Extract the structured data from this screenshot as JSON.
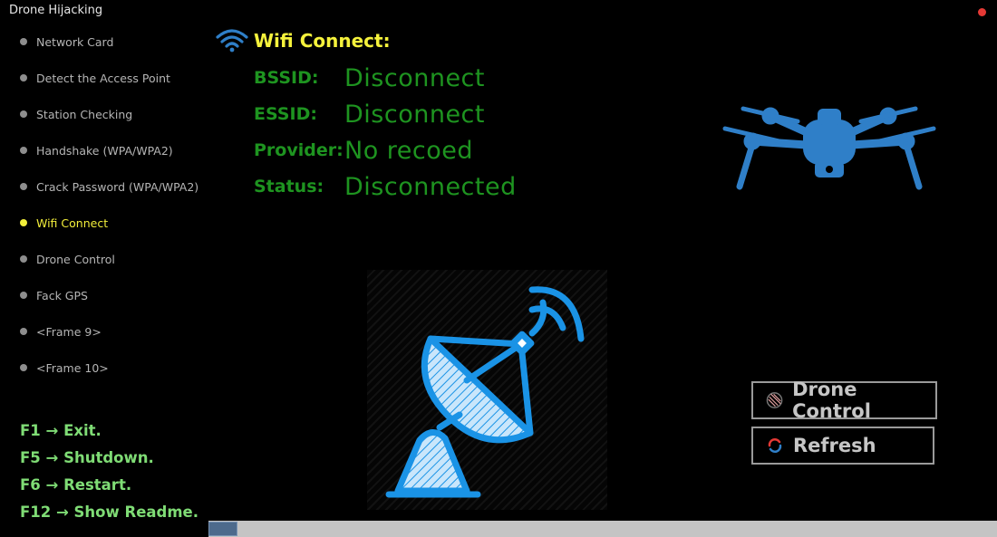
{
  "window": {
    "title": "Drone Hijacking"
  },
  "sidebar": {
    "items": [
      {
        "label": "Network Card",
        "active": false
      },
      {
        "label": "Detect the Access Point",
        "active": false
      },
      {
        "label": "Station Checking",
        "active": false
      },
      {
        "label": "Handshake (WPA/WPA2)",
        "active": false
      },
      {
        "label": "Crack Password (WPA/WPA2)",
        "active": false
      },
      {
        "label": "Wifi Connect",
        "active": true
      },
      {
        "label": "Drone Control",
        "active": false
      },
      {
        "label": "Fack GPS",
        "active": false
      },
      {
        "label": "<Frame 9>",
        "active": false
      },
      {
        "label": "<Frame 10>",
        "active": false
      }
    ],
    "shortcuts": [
      "F1 → Exit.",
      "F5 → Shutdown.",
      "F6 → Restart.",
      "F12 → Show Readme."
    ]
  },
  "main": {
    "title": "Wifi Connect:",
    "fields": [
      {
        "label": "BSSID:",
        "value": "Disconnect"
      },
      {
        "label": "ESSID:",
        "value": "Disconnect"
      },
      {
        "label": "Provider:",
        "value": "No recoed"
      },
      {
        "label": "Status:",
        "value": "Disconnected"
      }
    ]
  },
  "buttons": {
    "drone_control": "Drone Control",
    "refresh": "Refresh"
  },
  "icons": {
    "wifi": "wifi-icon",
    "drone": "drone-icon",
    "dish": "satellite-dish-icon",
    "drone_control_button": "pattern-icon",
    "refresh_button": "refresh-icon"
  },
  "colors": {
    "background": "#000000",
    "active_item": "#f2ee3a",
    "title": "#f5f23c",
    "field_text": "#1e9420",
    "shortcut_text": "#7fdc75",
    "drone_blue": "#2f7fc8",
    "dish_blue": "#1a93e6",
    "record_dot": "#e53935"
  }
}
